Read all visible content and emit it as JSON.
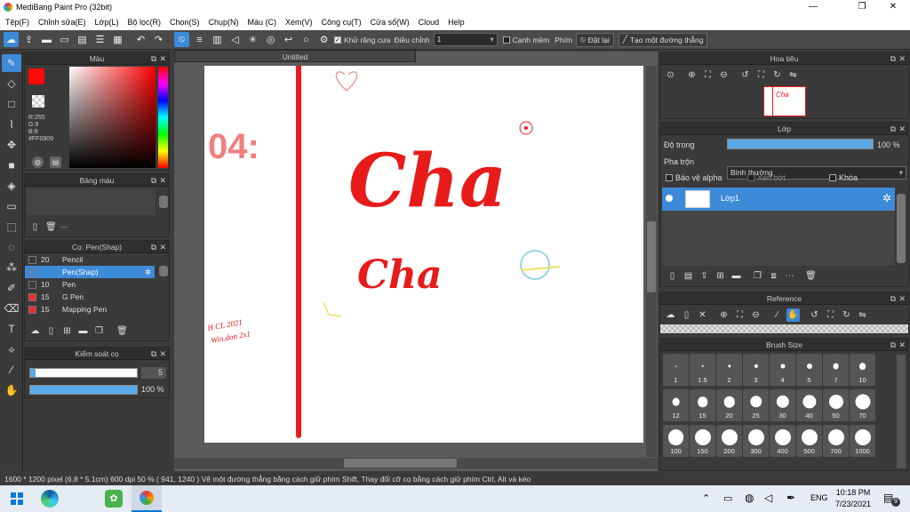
{
  "window": {
    "title": "MediBang Paint Pro (32bit)",
    "minimize": "—",
    "maximize": "❐",
    "close": "✕"
  },
  "menu": [
    "Tệp(F)",
    "Chỉnh sửa(E)",
    "Lớp(L)",
    "Bộ lọc(R)",
    "Chọn(S)",
    "Chụp(N)",
    "Màu (C)",
    "Xem(V)",
    "Công cụ(T)",
    "Cửa sổ(W)",
    "Cloud",
    "Help"
  ],
  "toolbar": {
    "antialias_label": "Khử răng cưa",
    "correction_label": "Điều chỉnh",
    "correction_value": "1",
    "soft_edge_label": "Cạnh mềm",
    "key_label": "Phím",
    "reset_label": "Đặt lại",
    "straight_line_label": "Tạo một đường thẳng"
  },
  "color_panel": {
    "title": "Màu",
    "r": "R:255",
    "g": "G:9",
    "b": "B:9",
    "hex": "#FF0909",
    "fg_color": "#ff0909"
  },
  "palette_panel": {
    "title": "Bảng màu",
    "placeholder": "---"
  },
  "brush_panel": {
    "title": "Cọ: Pen(Shap)",
    "items": [
      {
        "size": "20",
        "name": "Pencil",
        "color": "#2a2a2a"
      },
      {
        "size": "",
        "name": "Pen(Shap)",
        "color": "#2a2a2a"
      },
      {
        "size": "10",
        "name": "Pen",
        "color": "#2a2a2a"
      },
      {
        "size": "15",
        "name": "G Pen",
        "color": "#e83030"
      },
      {
        "size": "15",
        "name": "Mapping Pen",
        "color": "#e83030"
      }
    ]
  },
  "brush_control": {
    "title": "Kiểm soát cọ",
    "size": "5",
    "opacity": "100 %",
    "size_fraction": 0.05,
    "opacity_fraction": 1.0
  },
  "document": {
    "tab_title": "Untitled"
  },
  "navigator": {
    "title": "Hoa tiêu"
  },
  "layer_panel": {
    "title": "Lớp",
    "opacity_label": "Độ trong",
    "opacity_value": "100 %",
    "opacity_fraction": 1.0,
    "blend_label": "Pha trộn",
    "blend_value": "Bình thường",
    "protect_alpha": "Bảo vệ alpha",
    "clipping": "Xén bớt",
    "lock": "Khóa",
    "layers": [
      {
        "name": "Lớp1"
      }
    ]
  },
  "reference_panel": {
    "title": "Reference"
  },
  "brush_size_panel": {
    "title": "Brush Size",
    "sizes": [
      "1",
      "1.5",
      "2",
      "3",
      "4",
      "5",
      "7",
      "10",
      "12",
      "15",
      "20",
      "25",
      "30",
      "40",
      "50",
      "70",
      "100",
      "150",
      "200",
      "300",
      "400",
      "500",
      "700",
      "1000"
    ]
  },
  "status": {
    "text": "1600 * 1200 pixel   (6.8 * 5.1cm)   600 dpi   50 %   ( 941, 1240 )   Vẽ một đường thẳng bằng cách giữ phím Shift, Thay đổi cỡ cọ bằng cách giữ phím Ctrl, Alt và kéo"
  },
  "taskbar": {
    "time": "10:18 PM",
    "date": "7/23/2021",
    "lang": "ENG",
    "notif_count": "9"
  },
  "canvas_text": {
    "big": "Cha",
    "small": "Cha",
    "number": "04:",
    "signature_1": "H CL 2021",
    "signature_2": "Win.don 2x1"
  }
}
